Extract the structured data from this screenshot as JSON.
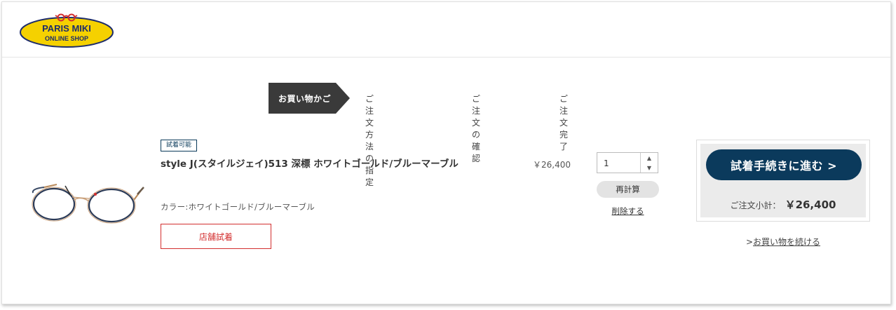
{
  "brand": {
    "line1": "PARIS MIKI",
    "line2": "ONLINE SHOP"
  },
  "steps": {
    "active": "お買い物かご",
    "s2": "ご注文方法の指定",
    "s3": "ご注文の確認",
    "s4": "ご注文完了"
  },
  "item": {
    "tag": "試着可能",
    "name": "style J(スタイルジェイ)513 深標 ホワイトゴールド/ブルーマーブル",
    "color": "カラー:ホワイトゴールド/ブルーマーブル",
    "store_button": "店舗試着",
    "price": "￥26,400",
    "quantity": "1",
    "recalc": "再計算",
    "delete": "削除する"
  },
  "checkout": {
    "proceed": "試着手続きに進む >",
    "subtotal_label": "ご注文小計：",
    "subtotal_value": "￥26,400",
    "continue_prefix": ">",
    "continue_link": "お買い物を続ける"
  },
  "colors": {
    "navy": "#0b3a5c",
    "dark_step": "#3a3a3a",
    "red": "#d32f2f",
    "logo_yellow": "#f5d100"
  }
}
